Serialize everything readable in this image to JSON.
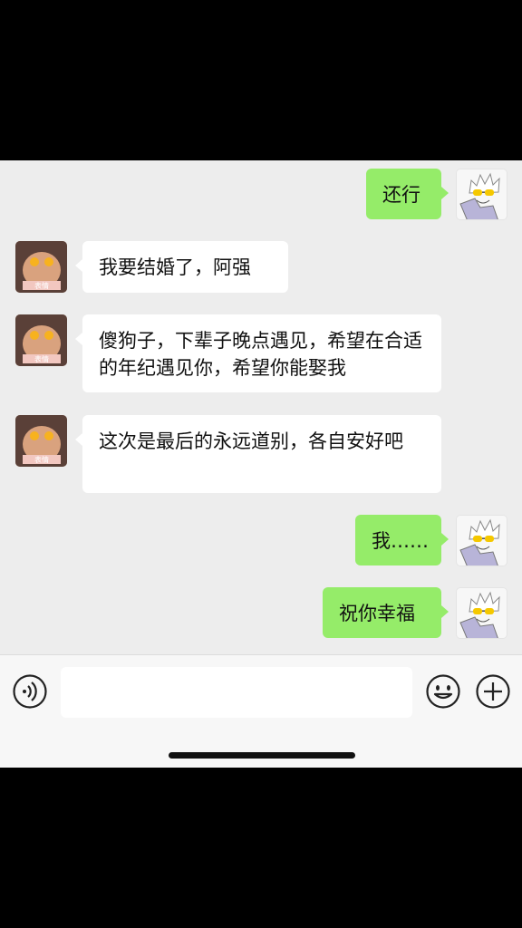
{
  "chat": {
    "messages": [
      {
        "side": "out",
        "text": "还行",
        "avatar_icon": "cartoon-boy-avatar-icon"
      },
      {
        "side": "in",
        "text": "我要结婚了，阿强",
        "avatar_icon": "cat-avatar-icon",
        "avatar_caption": "表情"
      },
      {
        "side": "in",
        "text": "傻狗子，下辈子晚点遇见，希望在合适的年纪遇见你，希望你能娶我",
        "avatar_icon": "cat-avatar-icon",
        "avatar_caption": "表情"
      },
      {
        "side": "in",
        "text": "这次是最后的永远道别，各自安好吧",
        "avatar_icon": "cat-avatar-icon",
        "avatar_caption": "表情"
      },
      {
        "side": "out",
        "text": "我……",
        "avatar_icon": "cartoon-boy-avatar-icon"
      },
      {
        "side": "out",
        "text": "祝你幸福",
        "avatar_icon": "cartoon-boy-avatar-icon"
      }
    ]
  },
  "input_bar": {
    "voice_icon": "voice-icon",
    "input_value": "",
    "emoji_icon": "emoji-icon",
    "add_icon": "plus-icon"
  },
  "colors": {
    "outgoing_bubble": "#95ec69",
    "incoming_bubble": "#ffffff",
    "chat_background": "#ededed"
  }
}
